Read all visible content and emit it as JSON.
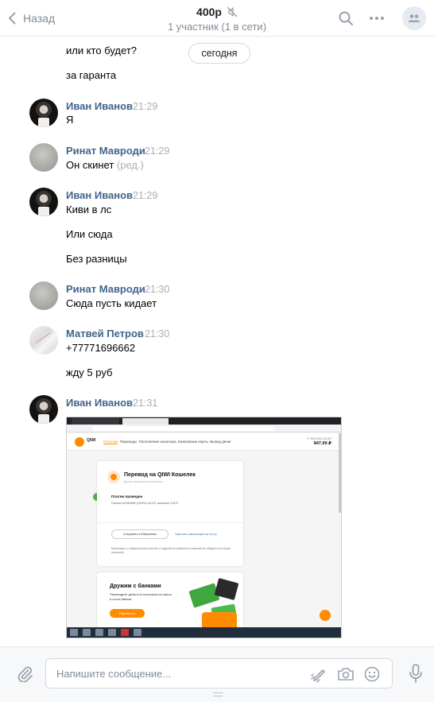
{
  "header": {
    "back_label": "Назад",
    "title": "400р",
    "subtitle": "1 участник (1 в сети)"
  },
  "date_separator": "сегодня",
  "messages": [
    {
      "author": "",
      "time": "",
      "lines": [
        "или кто будет?",
        "за гаранта"
      ]
    },
    {
      "author": "Иван Иванов",
      "time": "21:29",
      "avatar": "ivan",
      "lines": [
        "Я"
      ]
    },
    {
      "author": "Ринат Мавроди",
      "time": "21:29",
      "avatar": "rinat",
      "lines": [
        "Он скинет"
      ],
      "edited": "(ред.)"
    },
    {
      "author": "Иван Иванов",
      "time": "21:29",
      "avatar": "ivan",
      "lines": [
        "Киви в лс",
        "Или сюда",
        "Без разницы"
      ]
    },
    {
      "author": "Ринат Мавроди",
      "time": "21:30",
      "avatar": "rinat",
      "lines": [
        "Сюда пусть кидает"
      ]
    },
    {
      "author": "Матвей Петров",
      "time": "21:30",
      "avatar": "matvei",
      "lines": [
        "+77771696662",
        "жду 5 руб"
      ]
    },
    {
      "author": "Иван Иванов",
      "time": "21:31",
      "avatar": "ivan",
      "lines": []
    }
  ],
  "attachment": {
    "brand": "QIWI",
    "nav": [
      "Платежи",
      "Переводы",
      "Пополнение кошелька",
      "Банковские карты",
      "Вывод денег"
    ],
    "balance_phone": "+7 993 025-16-87",
    "balance": "847,99 ₽",
    "card_title": "Перевод на QIWI Кошелек",
    "card_subtitle": "Деньги зачислятся мгновенно",
    "status": "Платеж проведен",
    "details": "Платеж №1564689 (1000%) на 5 ₽, комиссия 0,05 ₽",
    "save_button": "Сохранить в Избранное",
    "receipt_link": "Прислать квитанцию на почту",
    "footer_text": "Кританцию о совершенном платеже и подробные реквизиты платежа вы найдете в истории платежей",
    "promo_title": "Дружим с банками",
    "promo_text": "Переводите деньги из кошелька на карты и счета банков",
    "promo_button": "Перевести"
  },
  "composer": {
    "placeholder": "Напишите сообщение..."
  },
  "colors": {
    "author": "#42648b",
    "muted": "#818c99",
    "qiwi_orange": "#ff8c00"
  }
}
